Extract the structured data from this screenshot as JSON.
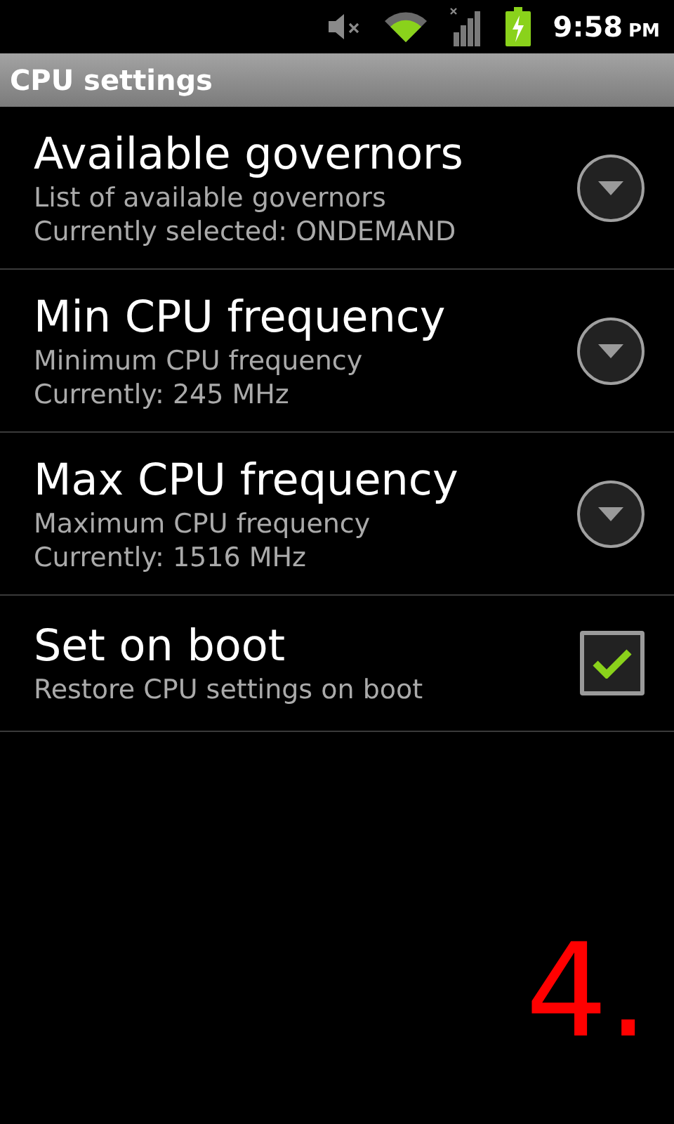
{
  "status_bar": {
    "time": "9:58",
    "ampm": "PM"
  },
  "title_bar": {
    "title": "CPU settings"
  },
  "settings": [
    {
      "kind": "list",
      "title": "Available governors",
      "summary": [
        "List of available governors",
        "Currently selected: ONDEMAND"
      ]
    },
    {
      "kind": "list",
      "title": "Min CPU frequency",
      "summary": [
        "Minimum CPU frequency",
        "Currently: 245 MHz"
      ]
    },
    {
      "kind": "list",
      "title": "Max CPU frequency",
      "summary": [
        "Maximum CPU frequency",
        "Currently: 1516 MHz"
      ]
    },
    {
      "kind": "checkbox",
      "title": "Set on boot",
      "summary": [
        "Restore CPU settings on boot"
      ],
      "checked": true
    }
  ],
  "step_label": "4."
}
